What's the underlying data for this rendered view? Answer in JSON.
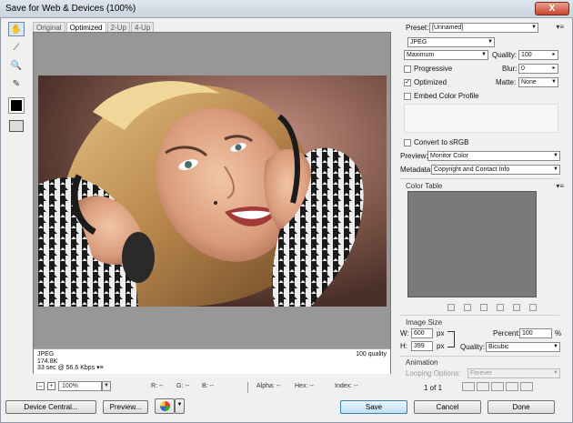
{
  "window": {
    "title": "Save for Web & Devices (100%)",
    "close": "X"
  },
  "tools": {
    "hand": "✋",
    "slice_select": "⟋",
    "zoom": "🔍",
    "eyedropper": "✎"
  },
  "tabs": [
    {
      "label": "Original"
    },
    {
      "label": "Optimized"
    },
    {
      "label": "2-Up"
    },
    {
      "label": "4-Up"
    }
  ],
  "preview": {
    "format": "JPEG",
    "size": "174.8K",
    "speed": "33 sec @ 56.6 Kbps",
    "speed_menu": "▾≡",
    "quality_label": "100 quality"
  },
  "statusbar": {
    "minus": "–",
    "plus": "+",
    "zoom": "100%",
    "r": "R: --",
    "g": "G: --",
    "b": "B: --",
    "alpha": "Alpha: --",
    "hex": "Hex: --",
    "index": "Index: --"
  },
  "buttons": {
    "device_central": "Device Central...",
    "preview": "Preview...",
    "save": "Save",
    "cancel": "Cancel",
    "done": "Done"
  },
  "panel": {
    "preset_label": "Preset:",
    "preset_value": "[Unnamed]",
    "format_value": "JPEG",
    "compression_value": "Maximum",
    "quality_label": "Quality:",
    "quality_value": "100",
    "blur_label": "Blur:",
    "blur_value": "0",
    "matte_label": "Matte:",
    "matte_value": "None",
    "progressive": "Progressive",
    "optimized": "Optimized",
    "embed_profile": "Embed Color Profile",
    "convert_srgb": "Convert to sRGB",
    "preview_label": "Preview:",
    "preview_value": "Monitor Color",
    "metadata_label": "Metadata:",
    "metadata_value": "Copyright and Contact Info",
    "color_table": "Color Table",
    "image_size": "Image Size",
    "w_label": "W:",
    "w_value": "600",
    "h_label": "H:",
    "h_value": "399",
    "px": "px",
    "percent_label": "Percent:",
    "percent_value": "100",
    "percent_unit": "%",
    "quality2_label": "Quality:",
    "quality2_value": "Bicubic",
    "animation": "Animation",
    "looping_label": "Looping Options:",
    "looping_value": "Forever",
    "frame_counter": "1 of 1"
  },
  "colors": {
    "canvas": "#979797",
    "save_accent": "#bfe0f5"
  }
}
